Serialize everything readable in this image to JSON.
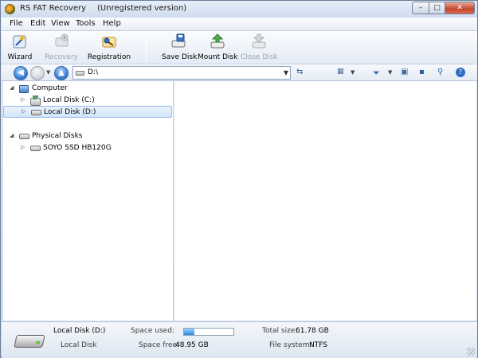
{
  "window": {
    "title": "RS FAT Recovery",
    "subtitle": "(Unregistered version)",
    "controls": {
      "minimize": "–",
      "maximize": "□",
      "close": "✕"
    }
  },
  "menu": [
    "File",
    "Edit",
    "View",
    "Tools",
    "Help"
  ],
  "toolbar": {
    "wizard": "Wizard",
    "recovery": "Recovery",
    "registration": "Registration",
    "save_disk": "Save Disk",
    "mount_disk": "Mount Disk",
    "close_disk": "Close Disk"
  },
  "nav": {
    "path": "D:\\",
    "back": "◀",
    "forward": "▶",
    "up": "▲"
  },
  "tree": {
    "computer_label": "Computer",
    "local_c": "Local Disk (C:)",
    "local_d": "Local Disk (D:)",
    "physical_label": "Physical Disks",
    "ssd": "SOYO SSD HB120G"
  },
  "status": {
    "disk_name": "Local Disk (D:)",
    "disk_type": "Local Disk",
    "space_used_label": "Space used:",
    "space_used_fraction": 0.21,
    "space_free_label": "Space free:",
    "space_free_value": "48.95 GB",
    "total_size_label": "Total size:",
    "total_size_value": "61.78 GB",
    "file_system_label": "File system:",
    "file_system_value": "NTFS"
  },
  "colors": {
    "accent": "#3b7fd4",
    "selection": "#d3e6fb"
  }
}
